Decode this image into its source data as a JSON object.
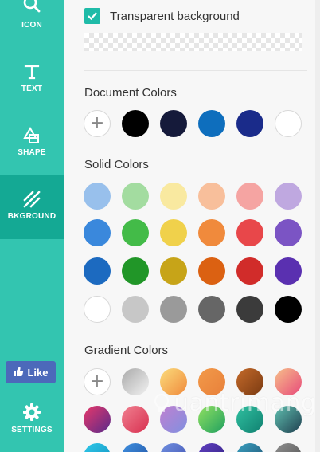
{
  "sidebar": {
    "items": [
      {
        "label": "ICON",
        "icon": "search-icon"
      },
      {
        "label": "TEXT",
        "icon": "text-icon"
      },
      {
        "label": "SHAPE",
        "icon": "shape-icon"
      },
      {
        "label": "BKGROUND",
        "icon": "background-icon",
        "active": true
      },
      {
        "label": "SETTINGS",
        "icon": "gear-icon"
      }
    ],
    "like_label": "Like",
    "colors": {
      "sidebar": "#33c5b0",
      "active": "#14a994",
      "like": "#4c69ba"
    }
  },
  "background": {
    "transparent_label": "Transparent background",
    "transparent_checked": true
  },
  "sections": {
    "document_title": "Document Colors",
    "solid_title": "Solid Colors",
    "gradient_title": "Gradient Colors"
  },
  "document_colors": [
    "#000000",
    "#151a3a",
    "#0e6ebd",
    "#1a2b8a",
    "#ffffff"
  ],
  "solid_colors": [
    [
      "#98c0ec",
      "#a3dca0",
      "#f9e9a0",
      "#f8bf9b",
      "#f5a4a2",
      "#bfa8e0"
    ],
    [
      "#3a88dc",
      "#43bb48",
      "#f0d14b",
      "#f08a3c",
      "#e8474a",
      "#7b54c4"
    ],
    [
      "#1c6ac0",
      "#219628",
      "#c7a418",
      "#db6112",
      "#d12c2a",
      "#5a30b0"
    ],
    [
      "#ffffff",
      "#c7c7c7",
      "#9a9a9a",
      "#666666",
      "#3b3b3b",
      "#000000"
    ]
  ],
  "gradient_colors": [
    [
      "linear-gradient(135deg,#aaaaaa,#f2f2f2)",
      "linear-gradient(135deg,#fbdc7c,#f08a3c)",
      "linear-gradient(135deg,#f29a4a,#e8803a)",
      "linear-gradient(135deg,#c46a2a,#7a3a12)",
      "linear-gradient(135deg,#f6c08a,#e84a7a)"
    ],
    [
      "linear-gradient(135deg,#e8386a,#5a2a8a)",
      "linear-gradient(135deg,#f08090,#d83050)",
      "linear-gradient(135deg,#c080d0,#8090e0)",
      "linear-gradient(135deg,#90e060,#20a060)",
      "linear-gradient(135deg,#30c0a0,#108070)",
      "linear-gradient(135deg,#60c0b0,#204050)"
    ],
    [
      "linear-gradient(135deg,#30c8e8,#1090c0)",
      "linear-gradient(135deg,#4090e0,#2050a0)",
      "linear-gradient(135deg,#7090e0,#4050b0)",
      "linear-gradient(135deg,#6040c0,#302080)",
      "linear-gradient(135deg,#3aa0c0,#205070)",
      "linear-gradient(135deg,#909090,#505050)"
    ]
  ],
  "watermark": {
    "text": "uantrimang"
  }
}
